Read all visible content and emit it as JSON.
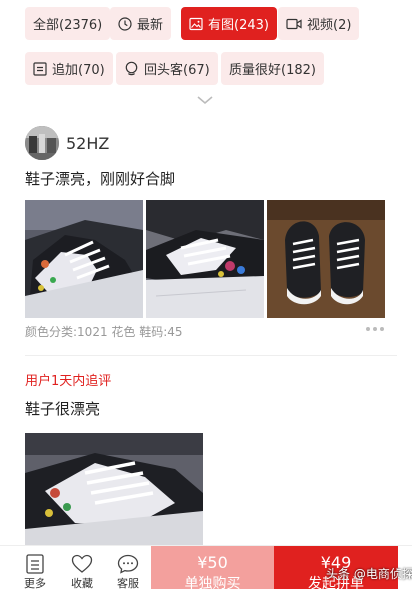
{
  "filters": {
    "row1": [
      {
        "label": "全部(2376)",
        "icon": "none",
        "active": false
      },
      {
        "label": "最新",
        "icon": "clock-icon",
        "active": false
      },
      {
        "label": "有图(243)",
        "icon": "image-icon",
        "active": true
      },
      {
        "label": "视频(2)",
        "icon": "video-icon",
        "active": false
      }
    ],
    "row2": [
      {
        "label": "追加(70)",
        "icon": "note-icon",
        "active": false
      },
      {
        "label": "回头客(67)",
        "icon": "returning-customer-icon",
        "active": false
      },
      {
        "label": "质量很好(182)",
        "icon": "none",
        "active": false
      }
    ]
  },
  "review": {
    "username": "52HZ",
    "text": "鞋子漂亮，刚刚好合脚",
    "specs": "颜色分类:1021 花色 鞋码:45",
    "followup_label": "用户1天内追评",
    "followup_text": "鞋子很漂亮"
  },
  "bottom_bar": {
    "more_label": "更多",
    "favorite_label": "收藏",
    "service_label": "客服",
    "single_price": "¥50",
    "single_action": "单独购买",
    "group_price": "¥49",
    "group_action": "发起拼单"
  },
  "watermark": "头条 @电商侦探",
  "colors": {
    "accent": "#e0211f",
    "chip_bg": "#fbeaea",
    "single_buy_bg": "#f3a09d",
    "muted_text": "#999999"
  }
}
